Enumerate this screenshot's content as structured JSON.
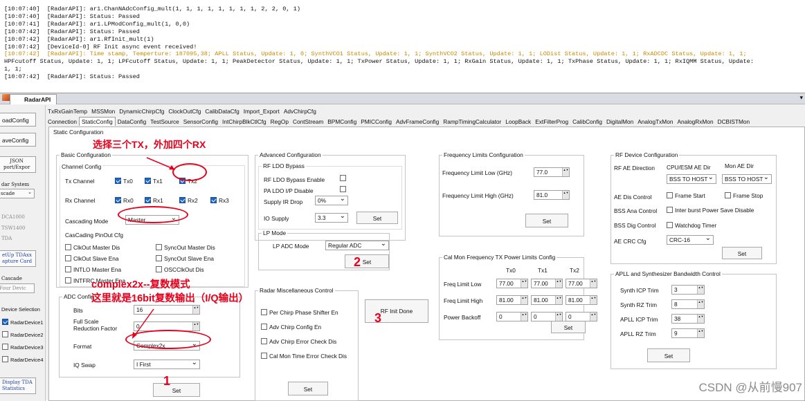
{
  "log": [
    {
      "text": "[10:07:40]  [RadarAPI]: ar1.ChanNAdcConfig_mult(1, 1, 1, 1, 1, 1, 1, 1, 2, 2, 0, 1)",
      "hl": false
    },
    {
      "text": "[10:07:40]  [RadarAPI]: Status: Passed",
      "hl": false
    },
    {
      "text": "[10:07:41]  [RadarAPI]: ar1.LPModConfig_mult(1, 0,0)",
      "hl": false
    },
    {
      "text": "[10:07:42]  [RadarAPI]: Status: Passed",
      "hl": false
    },
    {
      "text": "[10:07:42]  [RadarAPI]: ar1.RfInit_mult(1)",
      "hl": false
    },
    {
      "text": "[10:07:42]  [DeviceId-0] RF Init async event received!",
      "hl": false
    },
    {
      "text": "[10:07:42]  [RadarAPI]: Time stamp, Temperture: 187095,38; APLL Status, Update: 1, 0; SynthVCO1 Status, Update: 1, 1; SynthVCO2 Status, Update: 1, 1; LODist Status, Update: 1, 1; RxADCDC Status, Update: 1, 1;",
      "hl": true,
      "split": 58
    },
    {
      "text": "HPFcutoff Status, Update: 1, 1; LPFcutoff Status, Update: 1, 1; PeakDetector Status, Update: 1, 1; TxPower Status, Update: 1, 1; RxGain Status, Update: 1, 1; TxPhase Status, Update: 1, 1; RxIQMM Status, Update:",
      "hl": false
    },
    {
      "text": "1, 1;",
      "hl": false
    },
    {
      "text": "[10:07:42]  [RadarAPI]: Status: Passed",
      "hl": false
    }
  ],
  "window": {
    "tab": "RadarAPI",
    "menu_arrow": "▾"
  },
  "left": {
    "buttons": [
      "oadConfig",
      "aveConfig"
    ],
    "json_btn": [
      "JSON",
      "port/Expor"
    ],
    "radar_system": "dar System",
    "cascade": "scade",
    "devs": [
      "DCA1000",
      "TSW1400",
      "TDA"
    ],
    "setup": [
      "etUp TDAxx",
      "apture Card"
    ],
    "cascade2": "Cascade",
    "four": "Four Devic",
    "device_sel": "Device Selection",
    "devices": [
      {
        "label": "RadarDevice1",
        "on": true
      },
      {
        "label": "RadarDevice2",
        "on": false
      },
      {
        "label": "RadarDevice3",
        "on": false
      },
      {
        "label": "RadarDevice4",
        "on": false
      }
    ],
    "display": [
      "Display TDA",
      "Statistics"
    ]
  },
  "tabs_row1": [
    "TxRxGainTemp",
    "MSSMon",
    "DynamicChirpCfg",
    "ClockOutCfg",
    "CalibDataCfg",
    "Import_Export",
    "AdvChirpCfg"
  ],
  "tabs_row2": [
    "Connection",
    "StaticConfig",
    "DataConfig",
    "TestSource",
    "SensorConfig",
    "IntChirpBlkCtlCfg",
    "RegOp",
    "ContStream",
    "BPMConfig",
    "PMICConfig",
    "AdvFrameConfig",
    "RampTimingCalculator",
    "LoopBack",
    "ExtFilterProg",
    "CalibConfig",
    "DigitalMon",
    "AnalogTxMon",
    "AnalogRxMon",
    "DCBISTMon"
  ],
  "static_title": "Static Configuration",
  "basic": {
    "title": "Basic Configuration",
    "chan": "Channel Config",
    "tx_label": "Tx Channel",
    "tx": [
      "Tx0",
      "Tx1",
      "Tx2"
    ],
    "rx_label": "Rx Channel",
    "rx": [
      "Rx0",
      "Rx1",
      "Rx2",
      "Rx3"
    ],
    "casc_mode_label": "Cascading Mode",
    "casc_mode": "Master",
    "pinout": "CasCading PinOut Cfg",
    "pins": [
      "ClkOut Master Dis",
      "SyncOut Master Dis",
      "ClkOut Slave Ena",
      "SyncOut Slave Ena",
      "INTLO Master Ena",
      "OSCClkOut Dis",
      "INTFRC Master Ena"
    ]
  },
  "adc": {
    "title": "ADC Config",
    "bits_label": "Bits",
    "bits": "16",
    "fsr_label1": "Full Scale",
    "fsr_label2": "Reduction Factor",
    "fsr": "0",
    "format_label": "Format",
    "format": "Complex2x",
    "iq_label": "IQ Swap",
    "iq": "I First",
    "set": "Set"
  },
  "advanced": {
    "title": "Advanced Configuration",
    "ldo_title": "RF LDO Bypass",
    "ldo_en": "RF LDO Bypass Enable",
    "palo": "PA LDO I/P Disable",
    "supply_ir": "Supply IR Drop",
    "supply_ir_val": "0%",
    "io_supply": "IO Supply",
    "io_val": "3.3",
    "set": "Set",
    "lp_title": "LP Mode",
    "lp_adc": "LP ADC Mode",
    "lp_val": "Regular ADC",
    "lp_set": "Set"
  },
  "misc": {
    "title": "Radar Miscellaneous Control",
    "items": [
      "Per Chirp Phase Shifter En",
      "Adv Chirp Config En",
      "Adv Chirp Error Check Dis",
      "Cal Mon Time Error Check Dis"
    ],
    "set": "Set"
  },
  "rfinit": "RF Init Done",
  "freq": {
    "title": "Frequency Limits Configuration",
    "low_label": "Frequency Limit Low (GHz)",
    "low": "77.0",
    "high_label": "Frequency Limit High (GHz)",
    "high": "81.0",
    "set": "Set"
  },
  "calmon": {
    "title": "Cal Mon Frequency TX Power Limits Config",
    "cols": [
      "Tx0",
      "Tx1",
      "Tx2"
    ],
    "rows": [
      {
        "label": "Freq Limit Low",
        "vals": [
          "77.00",
          "77.00",
          "77.00"
        ]
      },
      {
        "label": "Freq Limit High",
        "vals": [
          "81.00",
          "81.00",
          "81.00"
        ]
      },
      {
        "label": "Power Backoff",
        "vals": [
          "0",
          "0",
          "0"
        ]
      }
    ],
    "set": "Set"
  },
  "rfdev": {
    "title": "RF Device Configuration",
    "ae_dir": "RF AE Direction",
    "cpu_dir": "CPU/ESM AE Dir",
    "mon_dir": "Mon AE Dir",
    "cpu_val": "BSS TO HOST",
    "mon_val": "BSS TO HOST",
    "ae_dis": "AE Dis Control",
    "frame_start": "Frame Start",
    "frame_stop": "Frame Stop",
    "bss_ana": "BSS Ana Control",
    "interburst": "Inter burst Power Save Disable",
    "bss_dig": "BSS Dig Control",
    "watchdog": "Watchdog Timer",
    "crc_label": "AE CRC Cfg",
    "crc": "CRC-16",
    "set": "Set"
  },
  "apll": {
    "title": "APLL and Synthesizer Bandwidth Control",
    "rows": [
      {
        "label": "Synth ICP Trim",
        "val": "3"
      },
      {
        "label": "Synth RZ Trim",
        "val": "8"
      },
      {
        "label": "APLL ICP Trim",
        "val": "38"
      },
      {
        "label": "APLL RZ Trim",
        "val": "9"
      }
    ],
    "set": "Set"
  },
  "annot": {
    "top": "选择三个TX，外加四个RX",
    "complex1": "complex2x--复数模式",
    "complex2": "这里就是16bit复数输出（I/Q输出）",
    "n1": "1",
    "n2": "2",
    "n3": "3"
  },
  "watermark": "CSDN @从前慢907",
  "colors": {
    "accent": "#1f66c2",
    "annot": "#e8001c",
    "log_hl": "#c98a00"
  }
}
